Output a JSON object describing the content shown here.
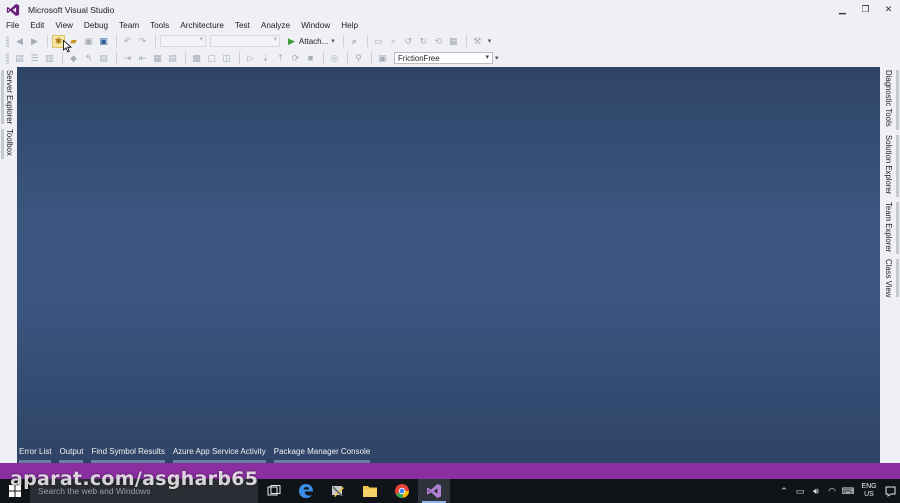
{
  "window": {
    "title": "Microsoft Visual Studio",
    "controls": {
      "minimize": "▁",
      "restore": "❐",
      "close": "✕"
    }
  },
  "menu": [
    "File",
    "Edit",
    "View",
    "Debug",
    "Team",
    "Tools",
    "Architecture",
    "Test",
    "Analyze",
    "Window",
    "Help"
  ],
  "toolbar": {
    "attach_label": "Attach...",
    "solution_config": "FrictionFree"
  },
  "side_left": [
    "Server Explorer",
    "Toolbox"
  ],
  "side_right": [
    "Diagnostic Tools",
    "Solution Explorer",
    "Team Explorer",
    "Class View"
  ],
  "bottom_tabs": [
    "Error List",
    "Output",
    "Find Symbol Results",
    "Azure App Service Activity",
    "Package Manager Console"
  ],
  "taskbar": {
    "search_placeholder": "Search the web and Windows",
    "lang_line1": "ENG",
    "lang_line2": "US"
  },
  "watermark": "aparat.com/asgharb65",
  "colors": {
    "accent": "#68217a",
    "status_bar": "#8b2fa0",
    "editor_bg": "#3b5780",
    "taskbar_bg": "#101317"
  }
}
